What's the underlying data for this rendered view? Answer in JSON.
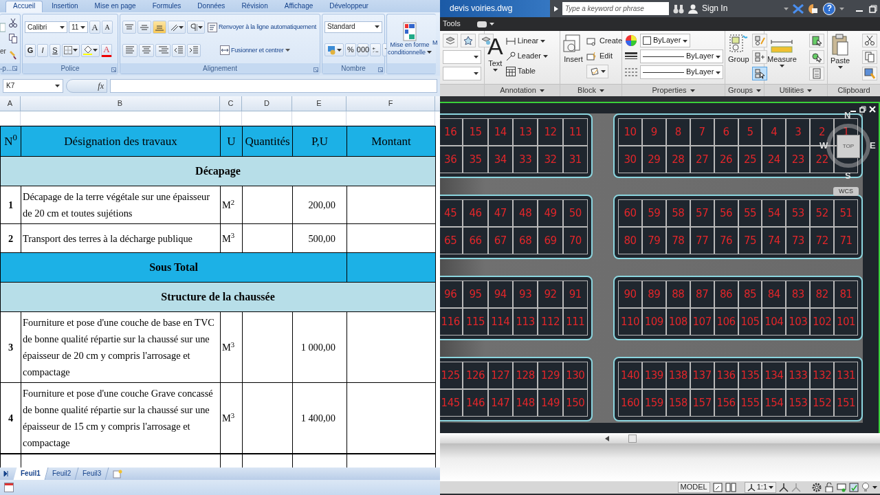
{
  "excel": {
    "tabs": [
      {
        "label": "Accueil",
        "selected": true
      },
      {
        "label": "Insertion",
        "selected": false
      },
      {
        "label": "Mise en page",
        "selected": false
      },
      {
        "label": "Formules",
        "selected": false
      },
      {
        "label": "Données",
        "selected": false
      },
      {
        "label": "Révision",
        "selected": false
      },
      {
        "label": "Affichage",
        "selected": false
      },
      {
        "label": "Développeur",
        "selected": false
      }
    ],
    "ribbon": {
      "paste_label": "er",
      "clipboard_label": "-p...",
      "font": {
        "label": "Police",
        "font_name": "Calibri",
        "font_size": "11",
        "grow": "A",
        "shrink": "A",
        "bold": "G",
        "italic": "I",
        "underline": "S",
        "font_color": "A"
      },
      "alignment": {
        "label": "Alignement",
        "wrap": "Renvoyer à la ligne automatiquement",
        "merge": "Fusionner et centrer"
      },
      "number": {
        "label": "Nombre",
        "format": "Standard",
        "percent": "%",
        "thousands": "000"
      },
      "styles": {
        "conditional_lines": [
          "Mise en forme",
          "conditionnelle"
        ],
        "cut_label": "M"
      }
    },
    "name_box": "K7",
    "fx": "fx",
    "columns": [
      "A",
      "B",
      "C",
      "D",
      "E",
      "F"
    ],
    "header": [
      "N$^{0}$",
      "Désignation des travaux",
      "U",
      "Quantités",
      "P,U",
      "Montant"
    ],
    "rows": [
      {
        "kind": "section",
        "title": "Décapage"
      },
      {
        "kind": "item",
        "number": "1",
        "designation": "Décapage de la terre végétale sur une épaisseur de 20 cm et toutes sujétions",
        "unit": "M$^{2}$",
        "unit_price": "200,00"
      },
      {
        "kind": "item",
        "number": "2",
        "designation": "Transport des terres à la décharge publique",
        "unit": "M$^{3}$",
        "unit_price": "500,00"
      },
      {
        "kind": "subtotal",
        "title": "Sous Total"
      },
      {
        "kind": "section",
        "title": "Structure de la chaussée"
      },
      {
        "kind": "item",
        "number": "3",
        "designation": "Fourniture et pose d'une couche de base en TVC de bonne qualité répartie sur la chaussé sur une épaisseur de 20 cm y compris l'arrosage et compactage",
        "unit": "M$^{3}$",
        "unit_price": "1 000,00"
      },
      {
        "kind": "item",
        "number": "4",
        "designation": "Fourniture et pose d'une couche Grave concassé de bonne qualité répartie sur la chaussé sur une épaisseur de 15 cm y compris l'arrosage et compactage",
        "unit": "M$^{3}$",
        "unit_price": "1 400,00"
      }
    ],
    "sheets": [
      {
        "label": "Feuil1",
        "selected": true
      },
      {
        "label": "Feuil2",
        "selected": false
      },
      {
        "label": "Feuil3",
        "selected": false
      }
    ]
  },
  "autocad": {
    "title": "devis voiries.dwg",
    "search_placeholder": "Type a keyword or phrase",
    "sign_in": "Sign In",
    "help": "?",
    "menu": "Tools",
    "ribbon": {
      "text_glyph": "A",
      "text": "Text",
      "linear": "Linear",
      "leader": "Leader",
      "table": "Table",
      "insert": "Insert",
      "create": "Create",
      "edit": "Edit",
      "color_label": "ByLayer",
      "lineweight": "ByLayer",
      "linetype": "ByLayer",
      "group": "Group",
      "measure": "Measure",
      "paste": "Paste"
    },
    "panels": [
      {
        "label": "Annotation",
        "menu": true
      },
      {
        "label": "Block",
        "menu": true
      },
      {
        "label": "Properties",
        "menu": true
      },
      {
        "label": "Groups",
        "menu": true
      },
      {
        "label": "Utilities",
        "menu": true
      },
      {
        "label": "Clipboard",
        "menu": false
      }
    ],
    "blocks": [
      {
        "rows": [
          [
            "16",
            "15",
            "14",
            "13",
            "12",
            "11"
          ],
          [
            "36",
            "35",
            "34",
            "33",
            "32",
            "31"
          ]
        ]
      },
      {
        "rows": [
          [
            "10",
            "9",
            "8",
            "7",
            "6",
            "5",
            "4",
            "3",
            "2",
            "1"
          ],
          [
            "30",
            "29",
            "28",
            "27",
            "26",
            "25",
            "24",
            "23",
            "22"
          ]
        ]
      },
      {
        "rows": [
          [
            "45",
            "46",
            "47",
            "48",
            "49",
            "50"
          ],
          [
            "65",
            "66",
            "67",
            "68",
            "69",
            "70"
          ]
        ]
      },
      {
        "rows": [
          [
            "60",
            "59",
            "58",
            "57",
            "56",
            "55",
            "54",
            "53",
            "52",
            "51"
          ],
          [
            "80",
            "79",
            "78",
            "77",
            "76",
            "75",
            "74",
            "73",
            "72",
            "71"
          ]
        ]
      },
      {
        "rows": [
          [
            "96",
            "95",
            "94",
            "93",
            "92",
            "91"
          ],
          [
            "116",
            "115",
            "114",
            "113",
            "112",
            "111"
          ]
        ]
      },
      {
        "rows": [
          [
            "90",
            "89",
            "88",
            "87",
            "86",
            "85",
            "84",
            "83",
            "82",
            "81"
          ],
          [
            "110",
            "109",
            "108",
            "107",
            "106",
            "105",
            "104",
            "103",
            "102",
            "101"
          ]
        ]
      },
      {
        "rows": [
          [
            "125",
            "126",
            "127",
            "128",
            "129",
            "130"
          ],
          [
            "145",
            "146",
            "147",
            "148",
            "149",
            "150"
          ]
        ]
      },
      {
        "rows": [
          [
            "140",
            "139",
            "138",
            "137",
            "136",
            "135",
            "134",
            "133",
            "132",
            "131"
          ],
          [
            "160",
            "159",
            "158",
            "157",
            "156",
            "155",
            "154",
            "153",
            "152",
            "151"
          ]
        ]
      }
    ],
    "viewcube": {
      "n": "N",
      "s": "S",
      "e": "E",
      "w": "W",
      "top": "TOP",
      "ucs": "WCS"
    },
    "status": {
      "model": "MODEL",
      "scale": "1:1"
    }
  }
}
